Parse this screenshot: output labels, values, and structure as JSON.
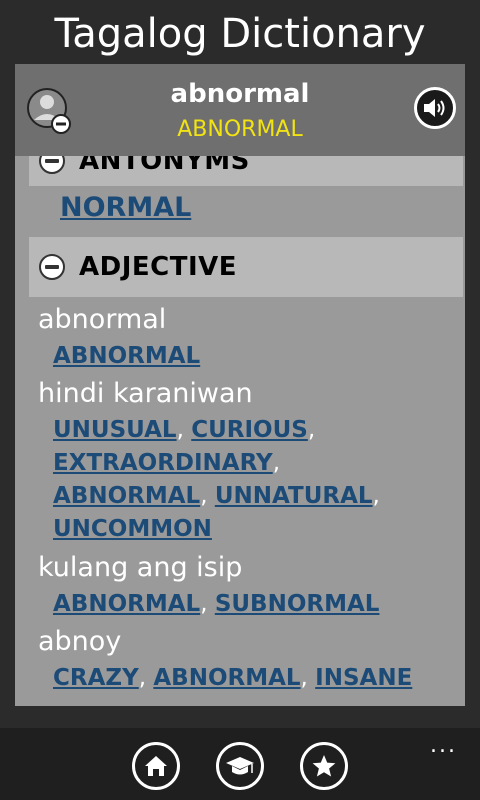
{
  "app": {
    "title": "Tagalog Dictionary"
  },
  "word": {
    "title": "abnormal",
    "upper": "ABNORMAL"
  },
  "antonyms": {
    "header": "ANTONYMS",
    "items": [
      "NORMAL"
    ]
  },
  "adjective": {
    "header": "ADJECTIVE",
    "senses": [
      {
        "term": "abnormal",
        "links": [
          "ABNORMAL"
        ]
      },
      {
        "term": "hindi karaniwan",
        "links": [
          "UNUSUAL",
          "CURIOUS",
          "EXTRAORDINARY",
          "ABNORMAL",
          "UNNATURAL",
          "UNCOMMON"
        ]
      },
      {
        "term": "kulang ang isip",
        "links": [
          "ABNORMAL",
          "SUBNORMAL"
        ]
      },
      {
        "term": "abnoy",
        "links": [
          "CRAZY",
          "ABNORMAL",
          "INSANE"
        ]
      }
    ]
  },
  "separator": ",",
  "bottom_bar": {
    "more": "..."
  },
  "colors": {
    "link": "#1c4b78",
    "accent_yellow": "#f2e313",
    "panel": "#9a9a9a",
    "header": "#6f6f6f"
  },
  "icons": [
    "profile-remove-icon",
    "speaker-icon",
    "minus-circle-icon",
    "home-icon",
    "graduation-cap-icon",
    "star-icon"
  ]
}
